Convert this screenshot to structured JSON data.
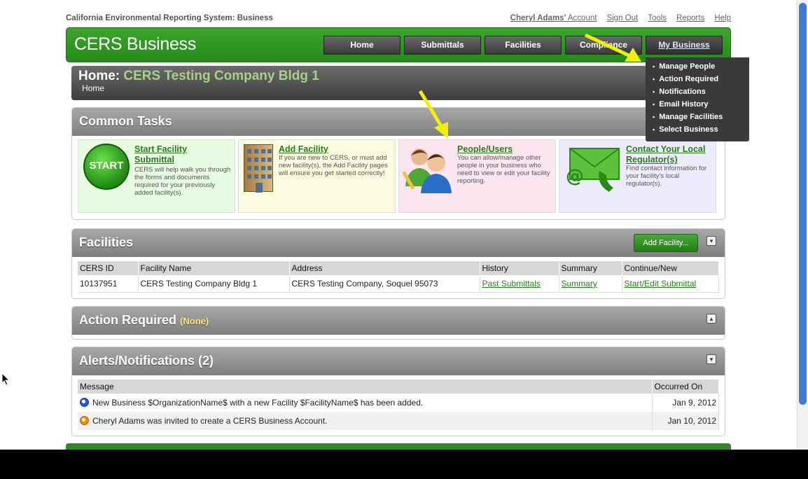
{
  "system_name": "California Environmental Reporting System: Business",
  "top_links": {
    "user_name": "Cheryl Adams'",
    "account": "Account",
    "sign_out": "Sign Out",
    "tools": "Tools",
    "reports": "Reports",
    "help": "Help"
  },
  "brand": "CERS Business",
  "nav": [
    "Home",
    "Submittals",
    "Facilities",
    "Compliance",
    "My Business"
  ],
  "dropdown": [
    "Manage People",
    "Action Required",
    "Notifications",
    "Email History",
    "Manage Facilities",
    "Select Business"
  ],
  "title": {
    "prefix": "Home:",
    "highlight": "CERS Testing Company Bldg 1",
    "breadcrumb": "Home"
  },
  "common_tasks": {
    "title": "Common Tasks",
    "start_badge": "START",
    "cards": [
      {
        "title": "Start Facility Submittal",
        "desc": "CERS will help walk you through the forms and documents required for your previously added facility(s)."
      },
      {
        "title": "Add Facility",
        "desc": "If you are new to CERS, or must add new facility(s), the Add Facility pages will ensure you get started correctly!"
      },
      {
        "title": "People/Users",
        "desc": "You can allow/manage other people in your business who need to view or edit your facility reporting."
      },
      {
        "title": "Contact Your Local Regulator(s)",
        "desc": "Find contact information for your facility's local regulator(s)."
      }
    ]
  },
  "facilities": {
    "title": "Facilities",
    "add_button": "Add Facility...",
    "headers": [
      "CERS ID",
      "Facility Name",
      "Address",
      "History",
      "Summary",
      "Continue/New"
    ],
    "rows": [
      [
        "10137951",
        "CERS Testing Company Bldg 1",
        "CERS Testing Company, Soquel 95073",
        "Past Submittals",
        "Summary",
        "Start/Edit Submittal"
      ]
    ]
  },
  "action_required": {
    "title": "Action Required",
    "count_label": "(None)"
  },
  "alerts": {
    "title": "Alerts/Notifications (2)",
    "headers": [
      "Message",
      "Occurred On"
    ],
    "rows": [
      {
        "icon": "blue",
        "message": "New Business $OrganizationName$ with a new Facility $FacilityName$ has been added.",
        "date": "Jan 9, 2012"
      },
      {
        "icon": "orange",
        "message": "Cheryl Adams was invited to create a CERS Business Account.",
        "date": "Jan 10, 2012"
      }
    ]
  },
  "colors": {
    "brand_green": "#2e9a22",
    "link_green": "#2a7b1e",
    "arrow_yellow": "#f2ef0c"
  }
}
